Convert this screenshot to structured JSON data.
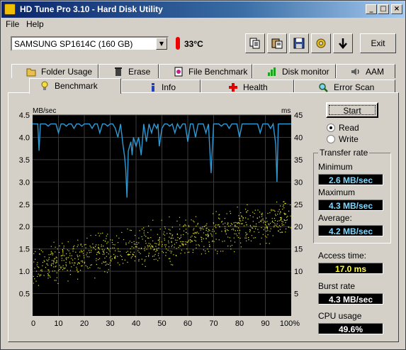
{
  "window": {
    "title": "HD Tune Pro 3.10 - Hard Disk Utility"
  },
  "titlebar_buttons": {
    "minimize": "_",
    "maximize": "□",
    "close": "×"
  },
  "menu": [
    {
      "label": "File"
    },
    {
      "label": "Help"
    }
  ],
  "drive": {
    "selected": "SAMSUNG SP1614C (160 GB)"
  },
  "temperature": "33°C",
  "toolbar": {
    "copy_icon": "copy-icon",
    "paste_icon": "paste-icon",
    "save_icon": "save-icon",
    "options_icon": "options-icon",
    "download_icon": "download-icon",
    "exit_label": "Exit"
  },
  "tabs_row1": [
    {
      "label": "Folder Usage",
      "icon": "folder-icon"
    },
    {
      "label": "Erase",
      "icon": "trash-icon"
    },
    {
      "label": "File Benchmark",
      "icon": "file-benchmark-icon"
    },
    {
      "label": "Disk monitor",
      "icon": "disk-monitor-icon"
    },
    {
      "label": "AAM",
      "icon": "speaker-icon"
    }
  ],
  "tabs_row2": [
    {
      "label": "Benchmark",
      "icon": "benchmark-icon"
    },
    {
      "label": "Info",
      "icon": "info-icon"
    },
    {
      "label": "Health",
      "icon": "health-icon"
    },
    {
      "label": "Error Scan",
      "icon": "error-scan-icon"
    }
  ],
  "benchmark": {
    "start_label": "Start",
    "mode": {
      "read_label": "Read",
      "write_label": "Write",
      "selected": "Read"
    },
    "transfer_rate_label": "Transfer rate",
    "minimum_label": "Minimum",
    "minimum_value": "2.6 MB/sec",
    "maximum_label": "Maximum",
    "maximum_value": "4.3 MB/sec",
    "average_label": "Average:",
    "average_value": "4.2 MB/sec",
    "access_time_label": "Access time:",
    "access_time_value": "17.0 ms",
    "burst_rate_label": "Burst rate",
    "burst_rate_value": "4.3 MB/sec",
    "cpu_usage_label": "CPU usage",
    "cpu_usage_value": "49.6%"
  },
  "colors": {
    "chart_bg": "#000000",
    "grid": "#3a3a3a",
    "transfer_line": "#2e9ad6",
    "access_points": "#e6e62a",
    "value_text": "#7fd7ff",
    "access_value_text": "#ffff40"
  },
  "chart_data": {
    "type": "line",
    "left_axis_label": "MB/sec",
    "right_axis_label": "ms",
    "ylim": [
      0,
      4.5
    ],
    "y2lim": [
      0,
      45
    ],
    "xlim": [
      0,
      100
    ],
    "y_ticks": [
      "0.5",
      "1.0",
      "1.5",
      "2.0",
      "2.5",
      "3.0",
      "3.5",
      "4.0",
      "4.5"
    ],
    "y2_ticks": [
      "5",
      "10",
      "15",
      "20",
      "25",
      "30",
      "35",
      "40",
      "45"
    ],
    "x_ticks": [
      "0",
      "10",
      "20",
      "30",
      "40",
      "50",
      "60",
      "70",
      "80",
      "90",
      "100%"
    ],
    "grid": true,
    "series": [
      {
        "kind": "transfer_rate",
        "x": [
          0,
          1,
          2,
          2.5,
          3,
          4,
          5,
          6,
          7,
          8,
          9,
          10,
          11,
          12,
          13,
          14,
          15,
          16,
          17,
          18,
          19,
          20,
          21,
          22,
          23,
          24,
          25,
          26,
          27,
          28,
          29,
          30,
          31,
          32,
          33,
          34,
          35,
          35.5,
          36,
          36.5,
          37,
          38,
          38.5,
          39,
          40,
          41,
          42,
          43,
          44,
          45,
          46,
          47,
          48,
          48.5,
          49,
          50,
          51,
          52,
          53,
          54,
          55,
          56,
          57,
          58,
          59,
          60,
          61,
          62,
          63,
          64,
          65,
          66,
          67,
          68,
          69,
          70,
          71,
          72,
          73,
          74,
          75,
          76,
          77,
          78,
          79,
          80,
          81,
          82,
          83,
          84,
          85,
          86,
          87,
          88,
          89,
          90,
          91,
          92,
          93,
          94,
          94.5,
          95,
          96,
          97,
          98,
          99,
          100
        ],
        "y": [
          4.3,
          4.3,
          4.3,
          3.7,
          4.3,
          4.3,
          4.3,
          4.25,
          4.3,
          4.3,
          4.3,
          4.1,
          4.3,
          4.3,
          4.25,
          4.3,
          4.3,
          4.2,
          4.3,
          4.3,
          4.25,
          4.3,
          4.3,
          4.3,
          4.2,
          4.3,
          4.3,
          4.1,
          4.3,
          4.3,
          4.25,
          4.3,
          4.3,
          4.2,
          4.0,
          4.3,
          3.8,
          3.6,
          3.3,
          2.65,
          3.7,
          3.9,
          3.6,
          4.0,
          3.8,
          4.0,
          3.6,
          4.3,
          3.9,
          4.3,
          4.1,
          4.3,
          4.2,
          4.3,
          3.8,
          4.2,
          4.3,
          4.3,
          4.25,
          4.3,
          4.1,
          4.3,
          4.2,
          4.3,
          4.3,
          3.9,
          4.3,
          4.3,
          4.0,
          4.3,
          4.3,
          4.3,
          4.1,
          4.3,
          3.2,
          4.3,
          4.3,
          4.3,
          4.25,
          4.3,
          4.3,
          4.2,
          4.3,
          4.3,
          4.3,
          4.0,
          4.3,
          4.3,
          4.3,
          4.3,
          4.3,
          4.3,
          4.3,
          4.1,
          4.3,
          4.3,
          4.3,
          4.2,
          4.3,
          3.85,
          3.0,
          4.3,
          4.3,
          4.3,
          4.3,
          4.3,
          4.3
        ]
      },
      {
        "kind": "access_time_scatter",
        "pattern": "points spread in a band rising from ~5-15 ms at 0% to ~18-26 ms at 100%",
        "ms_start_center": 11,
        "ms_end_center": 22,
        "spread_ms": 4.5,
        "count": 900
      }
    ]
  }
}
